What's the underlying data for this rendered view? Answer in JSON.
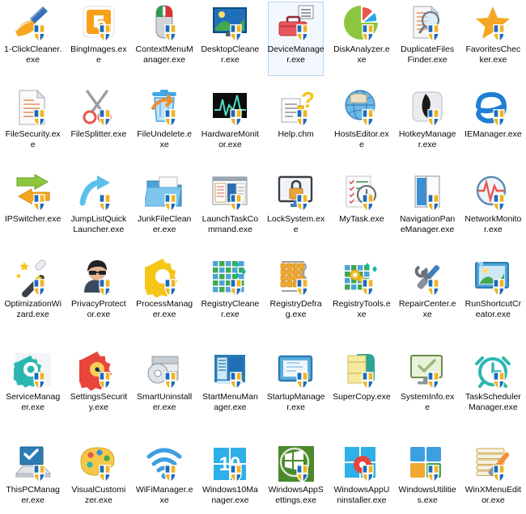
{
  "window": {
    "title": "Windows Utilities folder icon grid",
    "columns": 8,
    "rows": 6,
    "background_color": "#ffffff",
    "label_color": "#0a0a0a",
    "selection_fill": "#f2f8fd",
    "selection_border": "#b9d5ef"
  },
  "icons": [
    {
      "label": "1-ClickCleaner.exe",
      "icon": "broom-icon",
      "selected": false
    },
    {
      "label": "BingImages.exe",
      "icon": "bing-images-icon",
      "selected": false
    },
    {
      "label": "ContextMenuManager.exe",
      "icon": "mouse-icon",
      "selected": false
    },
    {
      "label": "DesktopCleaner.exe",
      "icon": "desktop-monitor-icon",
      "selected": false
    },
    {
      "label": "DeviceManager.exe",
      "icon": "toolbox-icon",
      "selected": true
    },
    {
      "label": "DiskAnalyzer.exe",
      "icon": "pie-chart-icon",
      "selected": false
    },
    {
      "label": "DuplicateFilesFinder.exe",
      "icon": "document-magnifier-icon",
      "selected": false
    },
    {
      "label": "FavoritesChecker.exe",
      "icon": "star-icon",
      "selected": false
    },
    {
      "label": "FileSecurity.exe",
      "icon": "document-icon",
      "selected": false
    },
    {
      "label": "FileSplitter.exe",
      "icon": "scissors-icon",
      "selected": false
    },
    {
      "label": "FileUndelete.exe",
      "icon": "trash-restore-icon",
      "selected": false
    },
    {
      "label": "HardwareMonitor.exe",
      "icon": "waveform-monitor-icon",
      "selected": false
    },
    {
      "label": "Help.chm",
      "icon": "help-question-icon",
      "selected": false
    },
    {
      "label": "HostsEditor.exe",
      "icon": "globe-icon",
      "selected": false
    },
    {
      "label": "HotkeyManager.exe",
      "icon": "hotkey-arrow-icon",
      "selected": false
    },
    {
      "label": "IEManager.exe",
      "icon": "internet-explorer-icon",
      "selected": false
    },
    {
      "label": "IPSwitcher.exe",
      "icon": "two-arrows-icon",
      "selected": false
    },
    {
      "label": "JumpListQuickLauncher.exe",
      "icon": "curved-arrow-icon",
      "selected": false
    },
    {
      "label": "JunkFileCleaner.exe",
      "icon": "folder-icon",
      "selected": false
    },
    {
      "label": "LaunchTaskCommand.exe",
      "icon": "task-window-icon",
      "selected": false
    },
    {
      "label": "LockSystem.exe",
      "icon": "lock-monitor-icon",
      "selected": false
    },
    {
      "label": "MyTask.exe",
      "icon": "checklist-clock-icon",
      "selected": false
    },
    {
      "label": "NavigationPaneManager.exe",
      "icon": "nav-pane-icon",
      "selected": false
    },
    {
      "label": "NetworkMonitor.exe",
      "icon": "network-pulse-icon",
      "selected": false
    },
    {
      "label": "OptimizationWizard.exe",
      "icon": "magic-wand-icon",
      "selected": false
    },
    {
      "label": "PrivacyProtector.exe",
      "icon": "spy-person-icon",
      "selected": false
    },
    {
      "label": "ProcessManager.exe",
      "icon": "gear-icon",
      "selected": false
    },
    {
      "label": "RegistryCleaner.exe",
      "icon": "registry-grid-icon",
      "selected": false
    },
    {
      "label": "RegistryDefrag.exe",
      "icon": "defrag-blocks-icon",
      "selected": false
    },
    {
      "label": "RegistryTools.exe",
      "icon": "wrench-grid-icon",
      "selected": false
    },
    {
      "label": "RepairCenter.exe",
      "icon": "wrench-screwdriver-icon",
      "selected": false
    },
    {
      "label": "RunShortcutCreator.exe",
      "icon": "shortcut-window-icon",
      "selected": false
    },
    {
      "label": "ServiceManager.exe",
      "icon": "teal-gear-icon",
      "selected": false
    },
    {
      "label": "SettingsSecurity.exe",
      "icon": "red-gear-icon",
      "selected": false
    },
    {
      "label": "SmartUninstaller.exe",
      "icon": "uninstall-disc-icon",
      "selected": false
    },
    {
      "label": "StartMenuManager.exe",
      "icon": "start-menu-icon",
      "selected": false
    },
    {
      "label": "StartupManager.exe",
      "icon": "startup-window-icon",
      "selected": false
    },
    {
      "label": "SuperCopy.exe",
      "icon": "copy-pages-icon",
      "selected": false
    },
    {
      "label": "SystemInfo.exe",
      "icon": "monitor-check-icon",
      "selected": false
    },
    {
      "label": "TaskSchedulerManager.exe",
      "icon": "alarm-clock-icon",
      "selected": false
    },
    {
      "label": "ThisPCManager.exe",
      "icon": "this-pc-icon",
      "selected": false
    },
    {
      "label": "VisualCustomizer.exe",
      "icon": "paint-palette-icon",
      "selected": false
    },
    {
      "label": "WiFiManager.exe",
      "icon": "wifi-icon",
      "selected": false
    },
    {
      "label": "Windows10Manager.exe",
      "icon": "windows10-icon",
      "selected": false
    },
    {
      "label": "WindowsAppSettings.exe",
      "icon": "app-settings-icon",
      "selected": false
    },
    {
      "label": "WindowsAppUninstaller.exe",
      "icon": "app-uninstall-icon",
      "selected": false
    },
    {
      "label": "WindowsUtilities.exe",
      "icon": "blocks-icon",
      "selected": false
    },
    {
      "label": "WinXMenuEditor.exe",
      "icon": "menu-edit-icon",
      "selected": false
    }
  ]
}
